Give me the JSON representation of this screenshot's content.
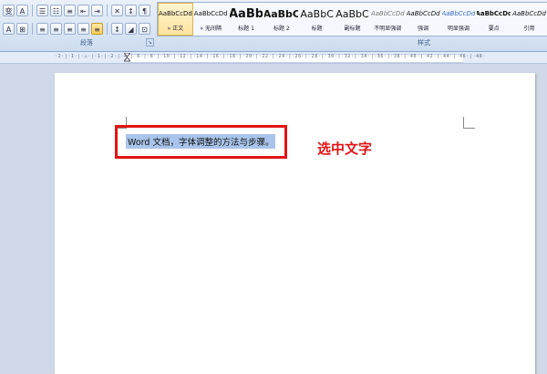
{
  "ribbon": {
    "paragraph_group_label": "段落",
    "styles_group_label": "样式",
    "row1_buttons": [
      {
        "glyph": "变",
        "icon": "phonetic-guide-icon"
      },
      {
        "glyph": "A",
        "icon": "char-border-icon"
      },
      {
        "glyph": "☰",
        "icon": "bullets-icon"
      },
      {
        "glyph": "☷",
        "icon": "numbering-icon"
      },
      {
        "glyph": "≡",
        "icon": "multilevel-list-icon"
      },
      {
        "glyph": "⇤",
        "icon": "decrease-indent-icon"
      },
      {
        "glyph": "⇥",
        "icon": "increase-indent-icon"
      },
      {
        "glyph": "✕",
        "icon": "chinese-layout-icon"
      },
      {
        "glyph": "↕",
        "icon": "sort-icon"
      },
      {
        "glyph": "¶",
        "icon": "show-marks-icon"
      }
    ],
    "row2_buttons": [
      {
        "glyph": "A",
        "icon": "char-shading-icon"
      },
      {
        "glyph": "⊞",
        "icon": "enclose-char-icon"
      },
      {
        "glyph": "≡",
        "icon": "align-left-icon"
      },
      {
        "glyph": "≡",
        "icon": "align-center-icon"
      },
      {
        "glyph": "≡",
        "icon": "align-right-icon"
      },
      {
        "glyph": "≡",
        "icon": "justify-icon"
      },
      {
        "glyph": "≡",
        "icon": "distributed-icon",
        "active": true
      },
      {
        "glyph": "↕",
        "icon": "line-spacing-icon"
      },
      {
        "glyph": "◢",
        "icon": "shading-icon"
      },
      {
        "glyph": "⊡",
        "icon": "borders-icon"
      }
    ],
    "styles": [
      {
        "sample": "AaBbCcDd",
        "name": "» 正文",
        "size": 7,
        "selected": true
      },
      {
        "sample": "AaBbCcDd",
        "name": "» 无间隔",
        "size": 7
      },
      {
        "sample": "AaBb",
        "name": "标题 1",
        "size": 13,
        "bold": true
      },
      {
        "sample": "AaBbC",
        "name": "标题 2",
        "size": 11,
        "bold": true
      },
      {
        "sample": "AaBbC",
        "name": "标题",
        "size": 11
      },
      {
        "sample": "AaBbC",
        "name": "副标题",
        "size": 11
      },
      {
        "sample": "AaBbCcDd",
        "name": "不明显强调",
        "size": 7,
        "italic": true,
        "color": "#7a7a7a"
      },
      {
        "sample": "AaBbCcDd",
        "name": "强调",
        "size": 7,
        "italic": true
      },
      {
        "sample": "AaBbCcDd",
        "name": "明显强调",
        "size": 7,
        "italic": true,
        "color": "#3a6fc4"
      },
      {
        "sample": "AaBbCcDd",
        "name": "要点",
        "size": 7,
        "bold": true
      },
      {
        "sample": "AaBbCcDd",
        "name": "引用",
        "size": 7,
        "italic": true
      }
    ]
  },
  "ruler": {
    "ticks": "·2·|·1·|·⊥·|·1·|·2·|·4·|·6·|·8·|·10·|·12·|·14·|·16·|·18·|·20·|·22·|·24·|·26·|·28·|·30·|·32·|·34·|·36·|·38·|·40·|·42·|·44·|·46·|·48·"
  },
  "document": {
    "selected_text": "Word 文档，字体调整的方法与步骤。",
    "annotation": "选中文字"
  },
  "colors": {
    "annotation_red": "#e21414",
    "selection_blue": "#a9c4ea"
  }
}
